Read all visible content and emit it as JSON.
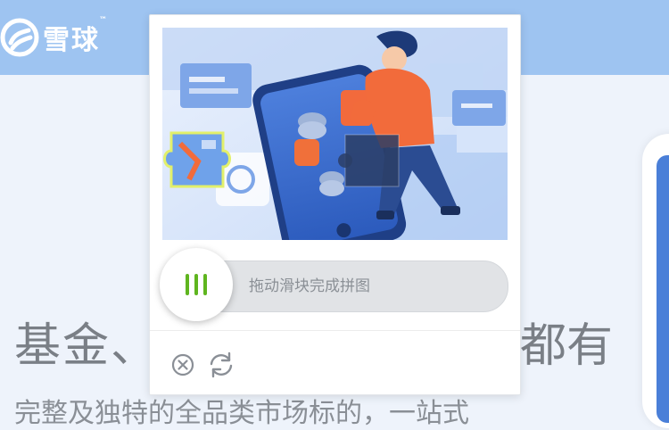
{
  "header": {
    "logo_text": "雪球",
    "logo_tm": "™"
  },
  "hero": {
    "title_left": "基金、",
    "title_right": "都有",
    "subtitle": "完整及独特的全品类市场标的，一站式"
  },
  "captcha": {
    "slider_hint": "拖动滑块完成拼图",
    "close_icon": "close-circle-icon",
    "refresh_icon": "refresh-icon",
    "accent_color": "#5fb51f"
  },
  "colors": {
    "header_bg": "#9ec4f1",
    "page_bg": "#eef3fb"
  }
}
